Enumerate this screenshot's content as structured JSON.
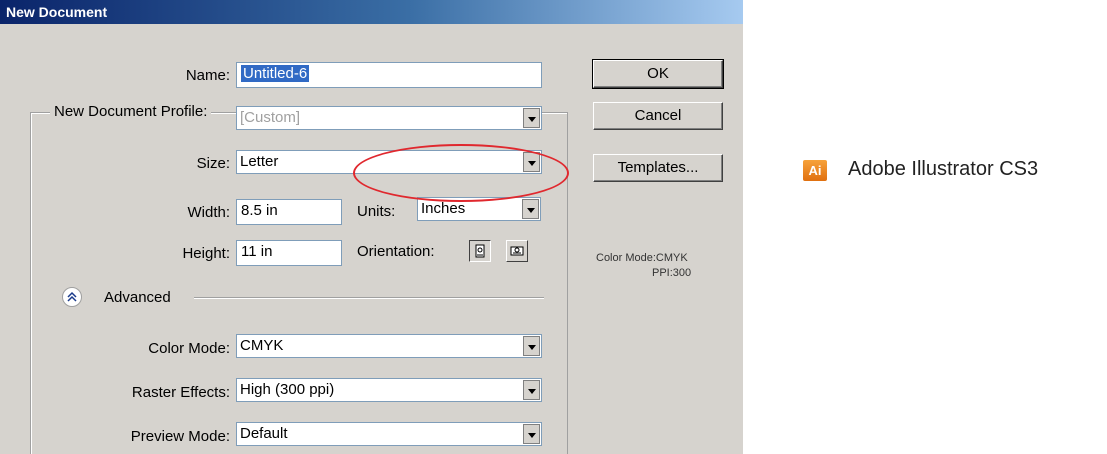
{
  "dialog": {
    "title": "New Document",
    "name": {
      "label": "Name:",
      "value": "Untitled-6"
    },
    "profile": {
      "label": "New Document Profile:",
      "value": "[Custom]"
    },
    "size": {
      "label": "Size:",
      "value": "Letter"
    },
    "width": {
      "label": "Width:",
      "value": "8.5 in"
    },
    "units": {
      "label": "Units:",
      "value": "Inches"
    },
    "height": {
      "label": "Height:",
      "value": "11 in"
    },
    "orientation": {
      "label": "Orientation:",
      "selected": "portrait"
    },
    "advanced": {
      "label": "Advanced"
    },
    "color_mode": {
      "label": "Color Mode:",
      "value": "CMYK"
    },
    "raster_effects": {
      "label": "Raster Effects:",
      "value": "High (300 ppi)"
    },
    "preview_mode": {
      "label": "Preview Mode:",
      "value": "Default"
    },
    "buttons": {
      "ok": "OK",
      "cancel": "Cancel",
      "templates": "Templates..."
    },
    "info": {
      "color_mode": "Color Mode:CMYK",
      "ppi": "PPI:300"
    }
  },
  "app_badge": {
    "icon_text": "Ai",
    "app_name": "Adobe Illustrator CS3"
  },
  "colors": {
    "dialog_bg": "#d6d3ce",
    "titlebar": "#0a246a",
    "highlight_circle": "#e0282e",
    "ai_badge": "#f7a23a"
  },
  "icons": [
    "chevron-double-up-icon",
    "portrait-icon",
    "landscape-icon",
    "dropdown-arrow-icon"
  ]
}
